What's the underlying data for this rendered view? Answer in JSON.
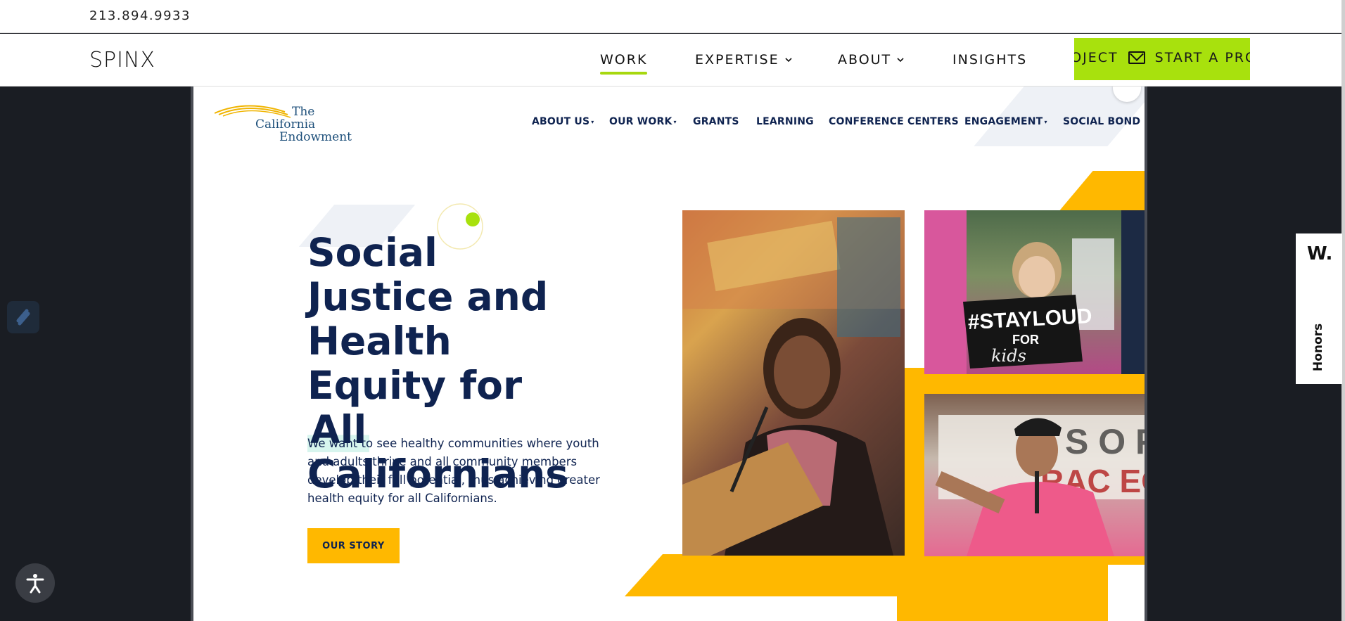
{
  "topbar": {
    "phone": "213.894.9933"
  },
  "header": {
    "logo": "SPINX",
    "nav": [
      {
        "label": "WORK",
        "active": true
      },
      {
        "label": "EXPERTISE",
        "dropdown": true
      },
      {
        "label": "ABOUT",
        "dropdown": true
      },
      {
        "label": "INSIGHTS"
      }
    ],
    "cta_label": "START A PROJECT",
    "cta_icon": "mail-icon",
    "accent_color": "#a8e10d"
  },
  "site": {
    "logo_line1": "The",
    "logo_line2": "California",
    "logo_line3": "Endowment",
    "nav": [
      {
        "label": "ABOUT US",
        "dropdown": true
      },
      {
        "label": "OUR WORK",
        "dropdown": true
      },
      {
        "label": "GRANTS"
      },
      {
        "label": "LEARNING"
      },
      {
        "label": "CONFERENCE CENTERS"
      },
      {
        "label": "ENGAGEMENT",
        "dropdown": true
      },
      {
        "label": "SOCIAL BOND"
      }
    ],
    "dropdown_marker": "▾",
    "hero": {
      "title_part1": "Social Justice and Health Equity for ",
      "title_highlight": "All",
      "title_part2": " Californians",
      "text": "We want to see healthy communities where youth and adults thrive and all community members develop their full potential, thus achieving greater health equity for all Californians.",
      "button": "OUR STORY"
    },
    "photo_sign_1": "#STAYLOUD",
    "photo_sign_2": "FOR",
    "photo_sign_3": "kids",
    "brand_colors": {
      "navy": "#0f2350",
      "yellow": "#ffb800"
    }
  },
  "widgets": {
    "honors_logo": "W.",
    "honors_label": "Honors"
  }
}
